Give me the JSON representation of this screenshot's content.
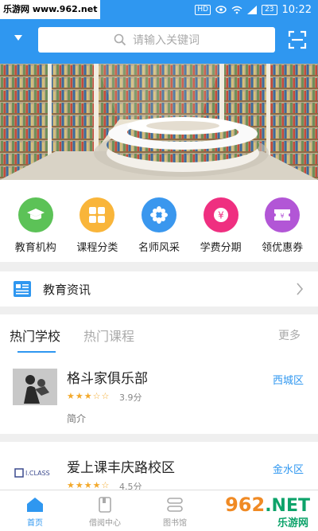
{
  "status_bar": {
    "watermark": "乐游网 www.962.net",
    "hd": "HD",
    "battery": "23",
    "time": "10:22"
  },
  "header": {
    "search_placeholder": "请输入关键词",
    "accent_color": "#2f97f0"
  },
  "categories": [
    {
      "label": "教育机构",
      "icon": "mortarboard-icon",
      "color": "#5cc257"
    },
    {
      "label": "课程分类",
      "icon": "grid-squares-icon",
      "color": "#f9b53a"
    },
    {
      "label": "名师风采",
      "icon": "flower-icon",
      "color": "#3a97ee"
    },
    {
      "label": "学费分期",
      "icon": "yen-icon",
      "color": "#ef2f80"
    },
    {
      "label": "领优惠券",
      "icon": "ticket-icon",
      "color": "#b256d6"
    }
  ],
  "news": {
    "title": "教育资讯"
  },
  "hot": {
    "tab_school": "热门学校",
    "tab_course": "热门课程",
    "more": "更多",
    "schools": [
      {
        "name": "格斗家俱乐部",
        "stars": "★★★☆☆",
        "score": "3.9分",
        "district": "西城区",
        "intro": "简介"
      },
      {
        "name": "爱上课丰庆路校区",
        "stars": "★★★★☆",
        "score": "4.5分",
        "district": "金水区",
        "logo_text": "I.CLASS"
      }
    ]
  },
  "bottom_nav": [
    {
      "label": "首页",
      "icon": "home-icon",
      "active": true
    },
    {
      "label": "借阅中心",
      "icon": "book-icon",
      "active": false
    },
    {
      "label": "图书馆",
      "icon": "library-icon",
      "active": false
    },
    {
      "label": "",
      "icon": "",
      "active": false
    }
  ],
  "watermark_bottom": {
    "brand": "962",
    "net": ".NET",
    "sub": "乐游网"
  }
}
